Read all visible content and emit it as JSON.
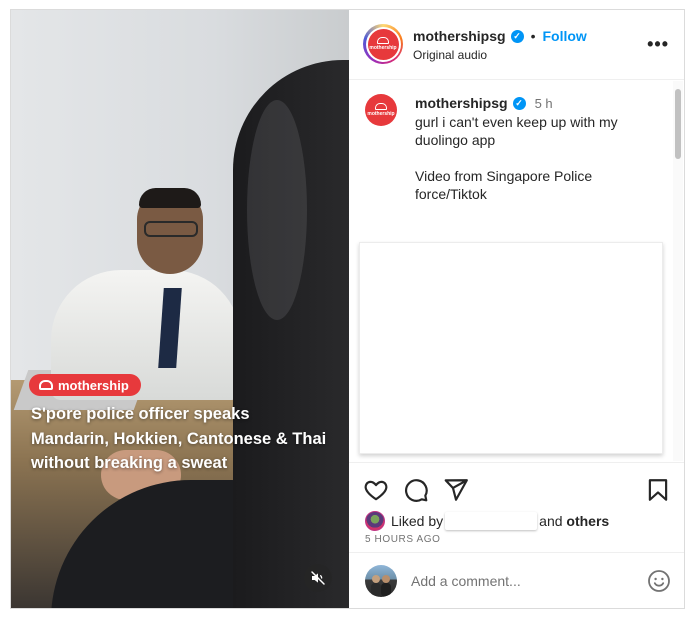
{
  "video": {
    "brand_label": "mothership",
    "caption": "S'pore police officer speaks Mandarin, Hokkien, Cantonese & Thai without breaking a sweat",
    "mute_icon": "speaker-muted-icon"
  },
  "header": {
    "username": "mothershipsg",
    "separator": "•",
    "follow_label": "Follow",
    "audio_label": "Original audio",
    "more_label": "•••",
    "avatar_text": "mothership"
  },
  "post": {
    "username": "mothershipsg",
    "time_ago": "5 h",
    "caption_line1": "gurl i can't even keep up with my duolingo app",
    "caption_line2": "Video from Singapore Police force/Tiktok"
  },
  "actions": {
    "liked_by_prefix": "Liked by",
    "liked_by_suffix": "and",
    "liked_by_others": "others",
    "timestamp": "5 HOURS AGO"
  },
  "comment_box": {
    "placeholder": "Add a comment..."
  },
  "colors": {
    "brand_red": "#e7393c",
    "link_blue": "#0095f6",
    "text": "#262626",
    "muted": "#737373"
  }
}
